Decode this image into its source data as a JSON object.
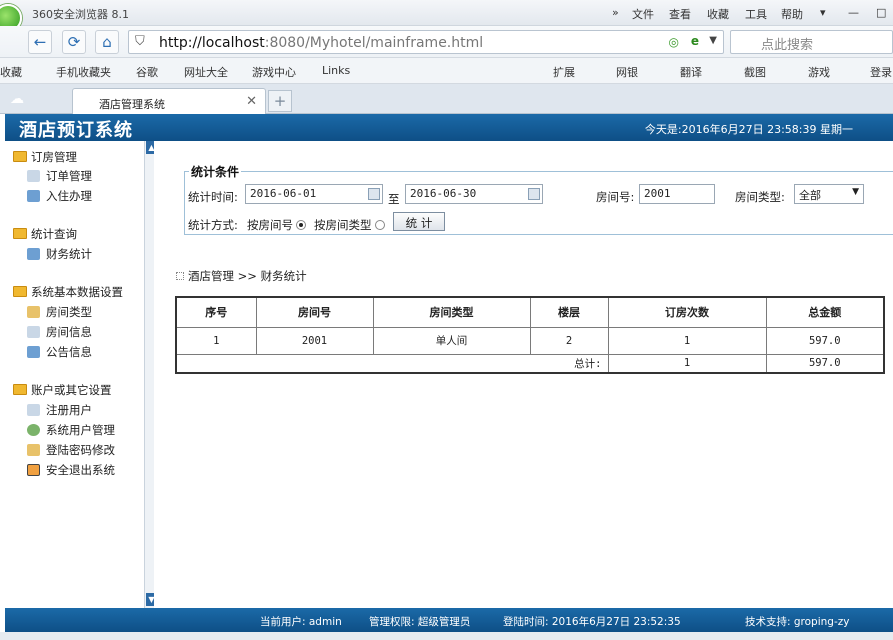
{
  "browser": {
    "name": "360安全浏览器 8.1",
    "menu": [
      "文件",
      "查看",
      "收藏",
      "工具",
      "帮助"
    ],
    "url_host": "http://localhost",
    "url_rest": ":8080/Myhotel/mainframe.html",
    "search_placeholder": "点此搜索",
    "favorites": [
      "收藏",
      "手机收藏夹",
      "谷歌",
      "网址大全",
      "游戏中心",
      "Links"
    ],
    "toolbar_right": [
      "扩展",
      "网银",
      "翻译",
      "截图",
      "游戏",
      "登录"
    ],
    "tab_title": "酒店管理系统"
  },
  "header": {
    "title": "酒店预订系统",
    "datetime": "今天是:2016年6月27日  23:58:39   星期一"
  },
  "sidebar": {
    "groups": [
      {
        "label": "订房管理",
        "items": [
          "订单管理",
          "入住办理"
        ]
      },
      {
        "label": "统计查询",
        "items": [
          "财务统计"
        ]
      },
      {
        "label": "系统基本数据设置",
        "items": [
          "房间类型",
          "房间信息",
          "公告信息"
        ]
      },
      {
        "label": "账户或其它设置",
        "items": [
          "注册用户",
          "系统用户管理",
          "登陆密码修改",
          "安全退出系统"
        ]
      }
    ]
  },
  "filter": {
    "legend": "统计条件",
    "time_label": "统计时间:",
    "date_from": "2016-06-01",
    "to_label": "至",
    "date_to": "2016-06-30",
    "room_no_label": "房间号:",
    "room_no": "2001",
    "room_type_label": "房间类型:",
    "room_type": "全部",
    "method_label": "统计方式:",
    "opt_room_no": "按房间号",
    "opt_room_type": "按房间类型",
    "submit": "统 计"
  },
  "breadcrumb": "酒店管理 >> 财务统计",
  "table": {
    "headers": [
      "序号",
      "房间号",
      "房间类型",
      "楼层",
      "订房次数",
      "总金额"
    ],
    "rows": [
      [
        "1",
        "2001",
        "单人间",
        "2",
        "1",
        "597.0"
      ]
    ],
    "total_label": "总计:",
    "total_count": "1",
    "total_amount": "597.0"
  },
  "status": {
    "user": "当前用户: admin",
    "role": "管理权限: 超级管理员",
    "login": "登陆时间: 2016年6月27日 23:52:35",
    "support": "技术支持: groping-zy"
  }
}
